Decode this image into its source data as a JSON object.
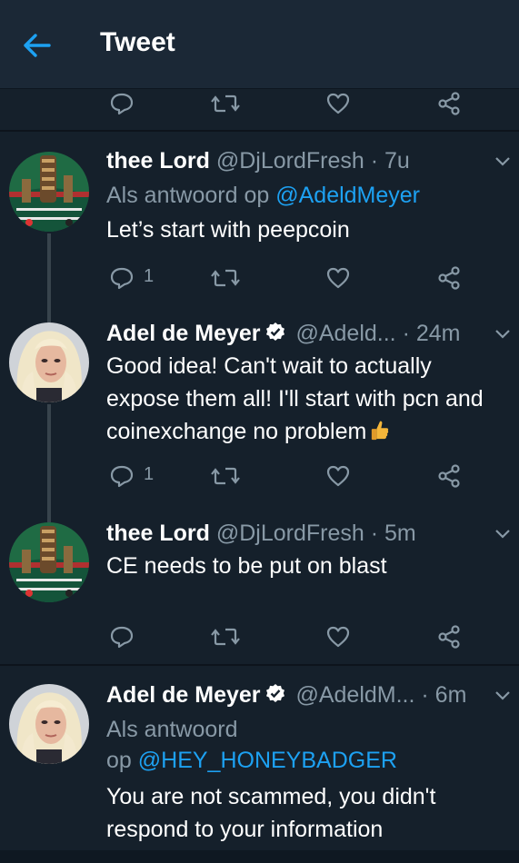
{
  "header": {
    "title": "Tweet"
  },
  "tweets": [
    {
      "name": "thee Lord",
      "handle": "@DjLordFresh",
      "time": "· 7u",
      "reply_prefix": "Als antwoord op",
      "reply_to": "@AdeldMeyer",
      "text": "Let’s start with peepcoin",
      "reply_count": "1"
    },
    {
      "name": "Adel de Meyer",
      "handle": "@Adeld...",
      "time": "· 24m",
      "text": "Good idea! Can't wait to actually expose them all! I'll start with pcn and coinexchange no problem",
      "reply_count": "1"
    },
    {
      "name": "thee Lord",
      "handle": "@DjLordFresh",
      "time": "· 5m",
      "text": "CE needs to be put on blast",
      "reply_count": ""
    },
    {
      "name": "Adel de Meyer",
      "handle": "@AdeldM...",
      "time": "· 6m",
      "reply_prefix": "Als antwoord",
      "reply_prefix2": "op",
      "reply_to": "@HEY_HONEYBADGER",
      "text": "You are not scammed, you didn't respond to your information"
    }
  ],
  "colors": {
    "background": "#15202b",
    "header": "#1b2836",
    "secondary_text": "#8899a6",
    "accent": "#1da1f2",
    "divider": "#0d141c"
  },
  "icons": [
    "back-arrow-icon",
    "reply-icon",
    "retweet-icon",
    "like-icon",
    "share-icon",
    "chevron-down-icon",
    "verified-badge-icon",
    "thumbs-up-emoji"
  ]
}
